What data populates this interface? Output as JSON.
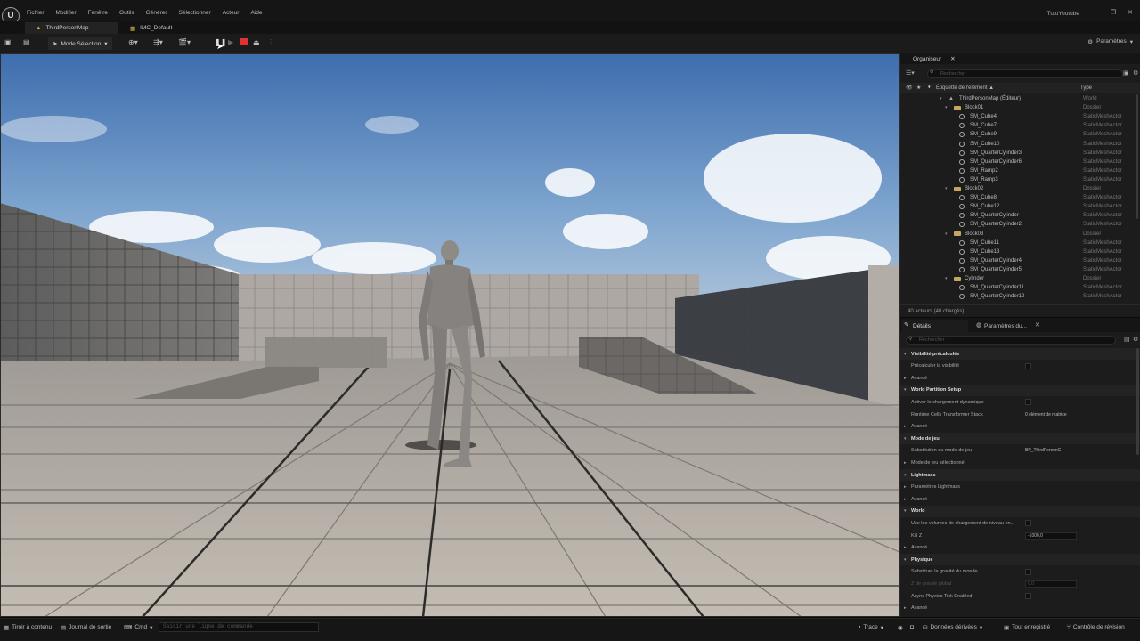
{
  "menubar": {
    "items": [
      "Fichier",
      "Modifier",
      "Fenêtre",
      "Outils",
      "Générer",
      "Sélectionner",
      "Acteur",
      "Aide"
    ],
    "app_name": "TutoYoutube"
  },
  "tabs": [
    {
      "label": "ThirdPersonMap"
    },
    {
      "label": "IMC_Default"
    }
  ],
  "toolbar": {
    "mode_label": "Mode Sélection",
    "settings_label": "Paramètres"
  },
  "outliner": {
    "title": "Organiseur",
    "search_placeholder": "Rechercher",
    "col_label": "Étiquette de l'élément ▲",
    "col_type": "Type",
    "rows": [
      {
        "label": "ThirdPersonMap (Éditeur)",
        "type": "World",
        "kind": "world",
        "indent": 0
      },
      {
        "label": "Block01",
        "type": "Dossier",
        "kind": "folder",
        "indent": 1
      },
      {
        "label": "SM_Cube4",
        "type": "StaticMeshActor",
        "kind": "mesh",
        "indent": 2
      },
      {
        "label": "SM_Cube7",
        "type": "StaticMeshActor",
        "kind": "mesh",
        "indent": 2
      },
      {
        "label": "SM_Cube9",
        "type": "StaticMeshActor",
        "kind": "mesh",
        "indent": 2
      },
      {
        "label": "SM_Cube10",
        "type": "StaticMeshActor",
        "kind": "mesh",
        "indent": 2
      },
      {
        "label": "SM_QuarterCylinder3",
        "type": "StaticMeshActor",
        "kind": "mesh",
        "indent": 2
      },
      {
        "label": "SM_QuarterCylinder6",
        "type": "StaticMeshActor",
        "kind": "mesh",
        "indent": 2
      },
      {
        "label": "SM_Ramp2",
        "type": "StaticMeshActor",
        "kind": "mesh",
        "indent": 2
      },
      {
        "label": "SM_Ramp3",
        "type": "StaticMeshActor",
        "kind": "mesh",
        "indent": 2
      },
      {
        "label": "Block02",
        "type": "Dossier",
        "kind": "folder",
        "indent": 1
      },
      {
        "label": "SM_Cube8",
        "type": "StaticMeshActor",
        "kind": "mesh",
        "indent": 2
      },
      {
        "label": "SM_Cube12",
        "type": "StaticMeshActor",
        "kind": "mesh",
        "indent": 2
      },
      {
        "label": "SM_QuarterCylinder",
        "type": "StaticMeshActor",
        "kind": "mesh",
        "indent": 2
      },
      {
        "label": "SM_QuarterCylinder2",
        "type": "StaticMeshActor",
        "kind": "mesh",
        "indent": 2
      },
      {
        "label": "Block03",
        "type": "Dossier",
        "kind": "folder",
        "indent": 1
      },
      {
        "label": "SM_Cube11",
        "type": "StaticMeshActor",
        "kind": "mesh",
        "indent": 2
      },
      {
        "label": "SM_Cube13",
        "type": "StaticMeshActor",
        "kind": "mesh",
        "indent": 2
      },
      {
        "label": "SM_QuarterCylinder4",
        "type": "StaticMeshActor",
        "kind": "mesh",
        "indent": 2
      },
      {
        "label": "SM_QuarterCylinder5",
        "type": "StaticMeshActor",
        "kind": "mesh",
        "indent": 2
      },
      {
        "label": "Cylinder",
        "type": "Dossier",
        "kind": "folder",
        "indent": 1
      },
      {
        "label": "SM_QuarterCylinder11",
        "type": "StaticMeshActor",
        "kind": "mesh",
        "indent": 2
      },
      {
        "label": "SM_QuarterCylinder12",
        "type": "StaticMeshActor",
        "kind": "mesh",
        "indent": 2
      }
    ],
    "footer": "40 acteurs (40 chargés)"
  },
  "details": {
    "tab1": "Détails",
    "tab2": "Paramètres du...",
    "search_placeholder": "Rechercher",
    "rows": [
      {
        "label": "Visibilité précalculée",
        "kind": "section"
      },
      {
        "label": "Précalculer la visibilité",
        "kind": "prop",
        "control": "check"
      },
      {
        "label": "Avancé",
        "kind": "expander"
      },
      {
        "label": "World Partition Setup",
        "kind": "section"
      },
      {
        "label": "Activer le chargement dynamique",
        "kind": "prop",
        "control": "check"
      },
      {
        "label": "Runtime Cells Transformer Stack",
        "kind": "prop",
        "value": "0 élément de matrice"
      },
      {
        "label": "Avancé",
        "kind": "expander"
      },
      {
        "label": "Mode de jeu",
        "kind": "section"
      },
      {
        "label": "Substitution du mode de jeu",
        "kind": "prop",
        "value": "BP_ThirdPersonG"
      },
      {
        "label": "Mode de jeu sélectionné",
        "kind": "expander"
      },
      {
        "label": "Lightmass",
        "kind": "section"
      },
      {
        "label": "Paramètres Lightmass",
        "kind": "expander"
      },
      {
        "label": "Avancé",
        "kind": "expander"
      },
      {
        "label": "World",
        "kind": "section"
      },
      {
        "label": "Use les volumes de chargement de niveau en...",
        "kind": "prop",
        "control": "check"
      },
      {
        "label": "Kill Z",
        "kind": "prop",
        "value": "-1000,0",
        "control": "input"
      },
      {
        "label": "Avancé",
        "kind": "expander"
      },
      {
        "label": "Physique",
        "kind": "section"
      },
      {
        "label": "Substituer la gravité du monde",
        "kind": "prop",
        "control": "check"
      },
      {
        "label": "Z de gravité global",
        "kind": "prop",
        "value": "0,0",
        "control": "input",
        "dim": true
      },
      {
        "label": "Async Physics Tick Enabled",
        "kind": "prop",
        "control": "check"
      },
      {
        "label": "Avancé",
        "kind": "expander"
      }
    ]
  },
  "statusbar": {
    "drawer": "Tiroir à contenu",
    "log": "Journal de sortie",
    "cmd": "Cmd",
    "cmd_placeholder": "Saisir une ligne de commande",
    "trace": "Trace",
    "derived": "Données dérivées",
    "saved": "Tout enregistré",
    "revision": "Contrôle de révision"
  },
  "colors": {
    "accent": "#e03434",
    "folder": "#c6a663",
    "sky_top": "#4d79b8",
    "floor": "#bdb6ad"
  }
}
